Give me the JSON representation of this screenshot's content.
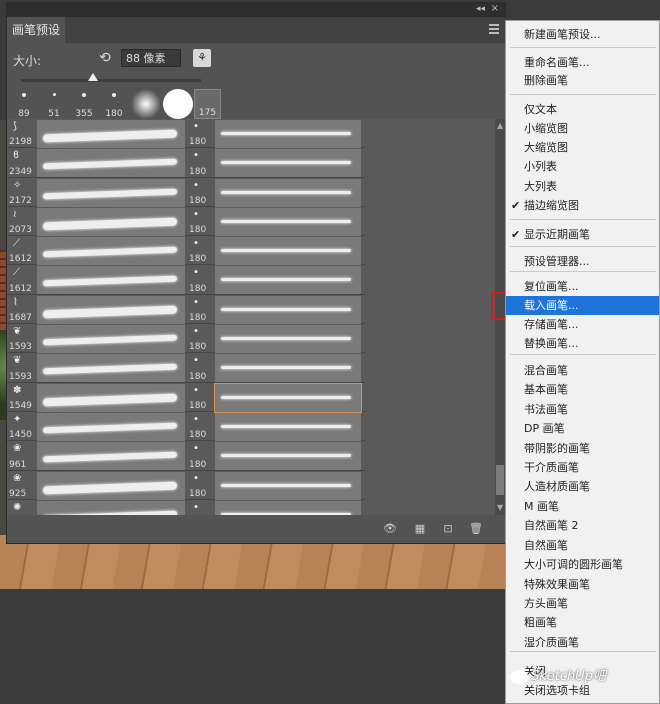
{
  "panel": {
    "tab_label": "画笔预设",
    "size_label": "大小:",
    "size_value": "88 像素",
    "size_slider_fraction": 0.4,
    "recent_brushes": [
      "89",
      "51",
      "355",
      "180",
      "175"
    ]
  },
  "brushes_left": [
    "2198",
    "2349",
    "2172",
    "2073",
    "1612",
    "1612",
    "1687",
    "1593",
    "1593",
    "1549",
    "1450",
    "961",
    "925",
    "1065"
  ],
  "brushes_right": [
    "180",
    "180",
    "180",
    "180",
    "180",
    "180",
    "180",
    "180",
    "180",
    "180",
    "180",
    "180",
    "180",
    "180"
  ],
  "menu": {
    "items": [
      {
        "label": "新建画笔预设...",
        "state": "normal"
      },
      {
        "label": "重命名画笔...",
        "state": "normal"
      },
      {
        "label": "删除画笔",
        "state": "normal"
      },
      {
        "label": "仅文本",
        "state": "normal"
      },
      {
        "label": "小缩览图",
        "state": "normal"
      },
      {
        "label": "大缩览图",
        "state": "normal"
      },
      {
        "label": "小列表",
        "state": "normal"
      },
      {
        "label": "大列表",
        "state": "normal"
      },
      {
        "label": "描边缩览图",
        "state": "checked"
      },
      {
        "label": "显示近期画笔",
        "state": "checked"
      },
      {
        "label": "预设管理器...",
        "state": "normal"
      },
      {
        "label": "复位画笔...",
        "state": "normal"
      },
      {
        "label": "载入画笔...",
        "state": "highlight"
      },
      {
        "label": "存储画笔...",
        "state": "normal"
      },
      {
        "label": "替换画笔...",
        "state": "normal"
      },
      {
        "label": "混合画笔",
        "state": "normal"
      },
      {
        "label": "基本画笔",
        "state": "normal"
      },
      {
        "label": "书法画笔",
        "state": "normal"
      },
      {
        "label": "DP 画笔",
        "state": "normal"
      },
      {
        "label": "带阴影的画笔",
        "state": "normal"
      },
      {
        "label": "干介质画笔",
        "state": "normal"
      },
      {
        "label": "人造材质画笔",
        "state": "normal"
      },
      {
        "label": "M 画笔",
        "state": "normal"
      },
      {
        "label": "自然画笔 2",
        "state": "normal"
      },
      {
        "label": "自然画笔",
        "state": "normal"
      },
      {
        "label": "大小可调的圆形画笔",
        "state": "normal"
      },
      {
        "label": "特殊效果画笔",
        "state": "normal"
      },
      {
        "label": "方头画笔",
        "state": "normal"
      },
      {
        "label": "粗画笔",
        "state": "normal"
      },
      {
        "label": "湿介质画笔",
        "state": "normal"
      },
      {
        "label": "关闭",
        "state": "normal"
      },
      {
        "label": "关闭选项卡组",
        "state": "normal"
      }
    ]
  },
  "watermark": "SketchUp吧",
  "colors": {
    "highlight": "#1e74d9",
    "callout": "#d21c1c",
    "selected_brush_outline": "#d89050"
  }
}
